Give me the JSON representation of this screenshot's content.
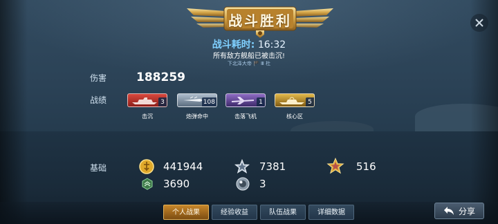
{
  "header": {
    "title": "战斗胜利",
    "time_label": "战斗耗时:",
    "time_value": "16:32",
    "message": "所有敌方舰船已被击沉!",
    "players": "下北泽大帝 🏴 Ⅲ 杜"
  },
  "stats": {
    "damage_label": "伤害",
    "damage_value": "188259",
    "achievements_label": "战绩",
    "medals": [
      {
        "label": "击沉",
        "count": "3",
        "color": "#b8312a"
      },
      {
        "label": "炮弹命中",
        "count": "108",
        "color": "#7f93a6"
      },
      {
        "label": "击落飞机",
        "count": "1",
        "color": "#6a4b9e"
      },
      {
        "label": "核心区",
        "count": "5",
        "color": "#c79a2a"
      }
    ],
    "base_label": "基础",
    "resources": [
      {
        "icon": "gold-coin-icon",
        "value": "441944"
      },
      {
        "icon": "silver-star-icon",
        "value": "7381"
      },
      {
        "icon": "gold-star-icon",
        "value": "516"
      },
      {
        "icon": "green-badge-icon",
        "value": "3690"
      },
      {
        "icon": "silver-orb-icon",
        "value": "3"
      }
    ]
  },
  "tabs": [
    "个人战果",
    "经验收益",
    "队伍战果",
    "详细数据"
  ],
  "active_tab": "个人战果",
  "share_label": "分享",
  "colors": {
    "accent_blue": "#7fd0ff",
    "tab_active": "#c7862a",
    "panel": "#2b4256"
  }
}
